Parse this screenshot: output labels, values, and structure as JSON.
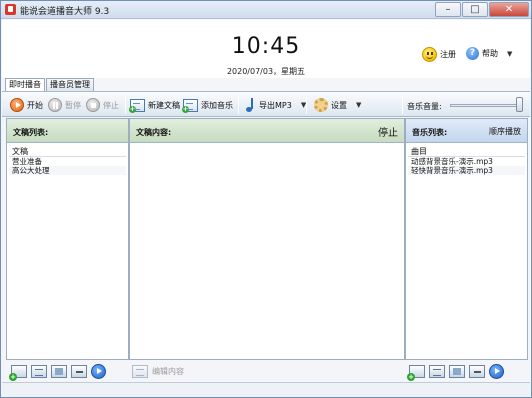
{
  "window": {
    "title": "能说会道播音大师 9.3",
    "minimize": "–",
    "maximize": "□",
    "close": "✕"
  },
  "header": {
    "clock": "10:45",
    "date": "2020/07/03，星期五",
    "register_label": "注册",
    "help_label": "帮助",
    "help_dropdown": "▼"
  },
  "tabs": [
    {
      "label": "即时播音",
      "active": true
    },
    {
      "label": "播音员管理",
      "active": false
    }
  ],
  "toolbar": {
    "start": "开始",
    "pause": "暂停",
    "stop": "停止",
    "new_doc": "新建文稿",
    "add_music": "添加音乐",
    "export_mp3": "导出MP3",
    "settings": "设置",
    "dropdown": "▼",
    "volume_label": "音乐音量:",
    "volume_level": 0.95
  },
  "doc_list": {
    "title": "文稿列表:",
    "column": "文稿",
    "items": [
      "营业准备",
      "高公大处理"
    ]
  },
  "doc_content": {
    "title": "文稿内容:",
    "status": "停止",
    "edit_label": "编辑内容"
  },
  "music_list": {
    "title": "音乐列表:",
    "mode": "顺序播放",
    "column": "曲目",
    "items": [
      "动感背景音乐-演示.mp3",
      "轻快背景音乐-演示.mp3"
    ]
  },
  "colors": {
    "green_header": "#c6dcbf",
    "blue_header": "#c3d6ee",
    "accent_orange": "#e2620c"
  }
}
